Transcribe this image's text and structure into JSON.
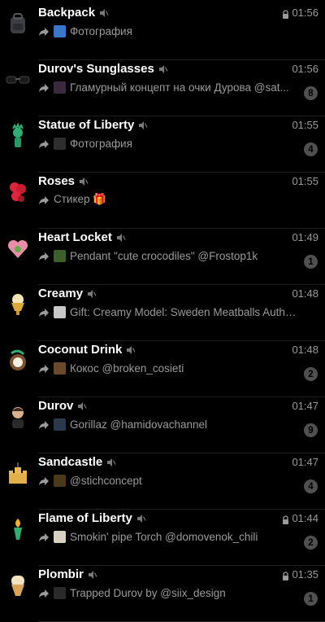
{
  "chats": [
    {
      "name": "Backpack",
      "time": "01:56",
      "lock": true,
      "preview": "Фотография",
      "badge": "",
      "avatar": "backpack-icon",
      "thumb_color": "#3a77c9"
    },
    {
      "name": "Durov's Sunglasses",
      "time": "01:56",
      "lock": false,
      "preview": "Гламурный концепт на очки Дурова @sat...",
      "badge": "8",
      "avatar": "sunglasses-icon",
      "thumb_color": "#3b2a3f"
    },
    {
      "name": "Statue of Liberty",
      "time": "01:55",
      "lock": false,
      "preview": "Фотография",
      "badge": "4",
      "avatar": "statue-icon",
      "thumb_color": "#2e2e2e"
    },
    {
      "name": "Roses",
      "time": "01:55",
      "lock": false,
      "preview": "Стикер 🎁",
      "badge": "",
      "avatar": "roses-icon",
      "thumb_color": ""
    },
    {
      "name": "Heart Locket",
      "time": "01:49",
      "lock": false,
      "preview": "Pendant \"cute crocodiles\" @Frostop1k",
      "badge": "1",
      "avatar": "heart-locket-icon",
      "thumb_color": "#3f5f2a"
    },
    {
      "name": "Creamy",
      "time": "01:48",
      "lock": false,
      "preview": "Gift: Creamy Model: Sweden Meatballs Author:...",
      "badge": "",
      "avatar": "ice-cream-cup-icon",
      "thumb_color": "#c8c8c8"
    },
    {
      "name": "Coconut Drink",
      "time": "01:48",
      "lock": false,
      "preview": "Кокос @broken_cosieti",
      "badge": "2",
      "avatar": "coconut-icon",
      "thumb_color": "#6a4a2a"
    },
    {
      "name": "Durov",
      "time": "01:47",
      "lock": false,
      "preview": "Gorillaz @hamidovachannel",
      "badge": "9",
      "avatar": "durov-avatar-icon",
      "thumb_color": "#2a3a4a"
    },
    {
      "name": "Sandcastle",
      "time": "01:47",
      "lock": false,
      "preview": "@stichconcept",
      "badge": "4",
      "avatar": "sandcastle-icon",
      "thumb_color": "#4a3a1a"
    },
    {
      "name": "Flame of Liberty",
      "time": "01:44",
      "lock": true,
      "preview": "Smokin' pipe Torch @domovenok_chili",
      "badge": "2",
      "avatar": "torch-icon",
      "thumb_color": "#d8d0c0"
    },
    {
      "name": "Plombir",
      "time": "01:35",
      "lock": true,
      "preview": "Trapped Durov by @siix_design",
      "badge": "1",
      "avatar": "ice-cream-icon",
      "thumb_color": "#2a2a2a"
    }
  ]
}
